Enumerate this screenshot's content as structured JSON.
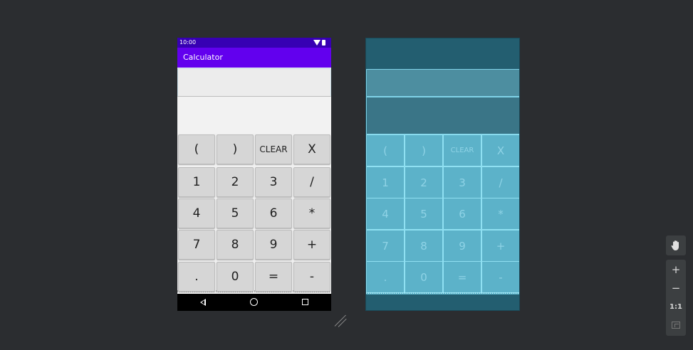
{
  "phone": {
    "status_time": "10:00",
    "app_title": "Calculator",
    "keys": [
      [
        "(",
        ")",
        "CLEAR",
        "X"
      ],
      [
        "1",
        "2",
        "3",
        "/"
      ],
      [
        "4",
        "5",
        "6",
        "*"
      ],
      [
        "7",
        "8",
        "9",
        "+"
      ],
      [
        ".",
        "0",
        "=",
        "-"
      ]
    ],
    "nav_icons": [
      "back-icon",
      "home-icon",
      "recent-apps-icon"
    ]
  },
  "blueprint": {
    "keys": [
      [
        "(",
        ")",
        "CLEAR",
        "X"
      ],
      [
        "1",
        "2",
        "3",
        "/"
      ],
      [
        "4",
        "5",
        "6",
        "*"
      ],
      [
        "7",
        "8",
        "9",
        "+"
      ],
      [
        ".",
        "0",
        "=",
        "-"
      ]
    ]
  },
  "zoom_controls": {
    "pan_icon": "hand-icon",
    "zoom_in": "+",
    "zoom_out": "−",
    "actual_size": "1:1",
    "fit_icon": "fit-screen-icon"
  },
  "colors": {
    "status_bar": "#3700b3",
    "app_bar": "#6200ee",
    "blueprint_bg": "#235e70",
    "blueprint_keys": "#5cb2c9"
  }
}
